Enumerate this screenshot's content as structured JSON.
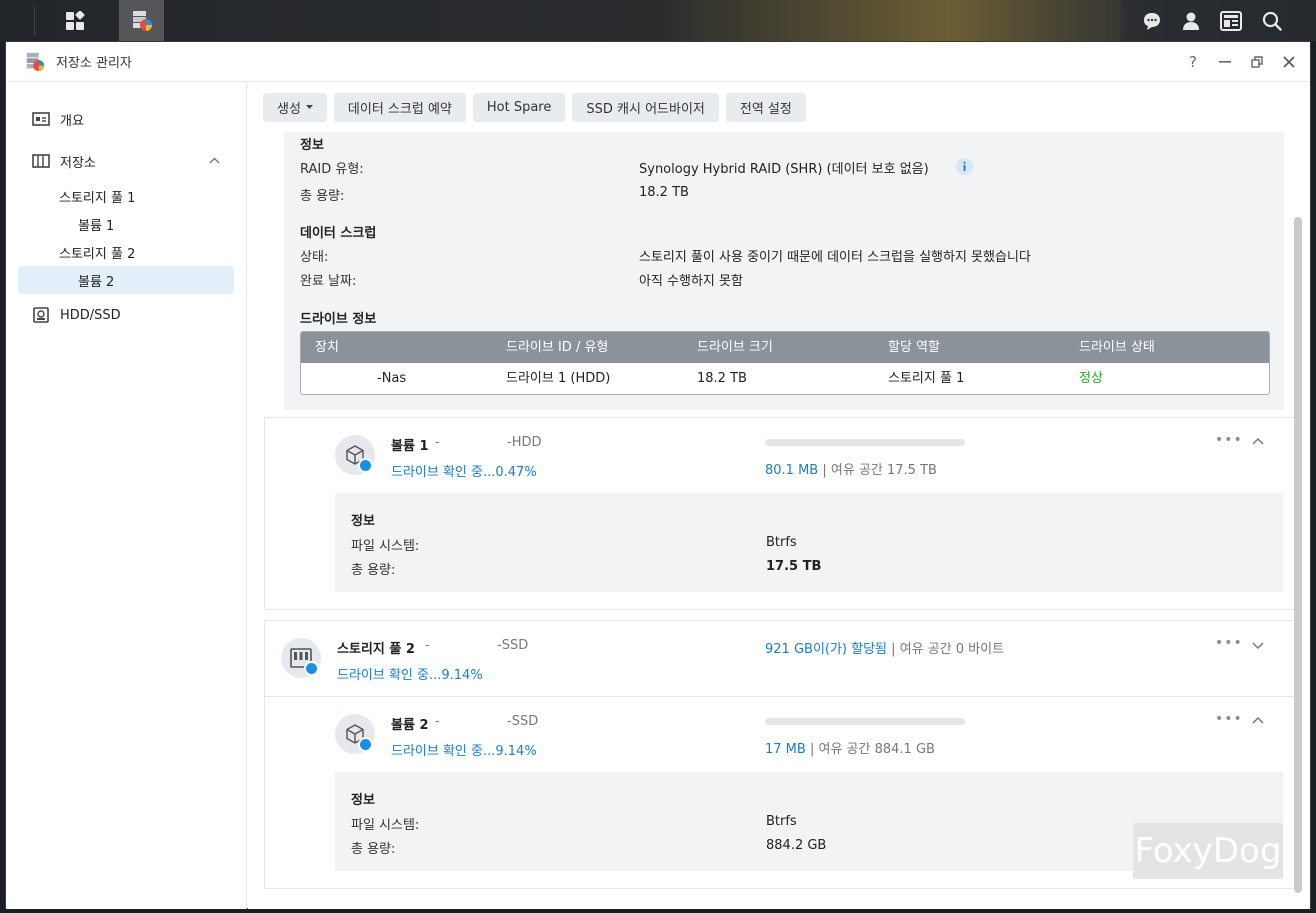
{
  "window": {
    "title": "저장소 관리자"
  },
  "toolbar": {
    "create": "생성",
    "scrub_schedule": "데이터 스크럽 예약",
    "hot_spare": "Hot Spare",
    "ssd_advisor": "SSD 캐시 어드바이저",
    "global_settings": "전역 설정"
  },
  "sidebar": {
    "overview": "개요",
    "storage": "저장소",
    "pool1": "스토리지 풀 1",
    "vol1": "볼륨 1",
    "pool2": "스토리지 풀 2",
    "vol2": "볼륨 2",
    "hddssd": "HDD/SSD"
  },
  "pool1_info": {
    "info_head": "정보",
    "raid_label": "RAID 유형:",
    "raid_value": "Synology Hybrid RAID (SHR) (데이터 보호 없음)",
    "capacity_label": "총 용량:",
    "capacity_value": "18.2 TB",
    "scrub_head": "데이터 스크럽",
    "status_label": "상태:",
    "status_value": "스토리지 풀이 사용 중이기 때문에 데이터 스크럽을 실행하지 못했습니다",
    "date_label": "완료 날짜:",
    "date_value": "아직 수행하지 못함",
    "drive_head": "드라이브 정보"
  },
  "drive_table": {
    "headers": [
      "장치",
      "드라이브 ID / 유형",
      "드라이브 크기",
      "할당 역할",
      "드라이브 상태"
    ],
    "row": [
      "-Nas",
      "드라이브 1 (HDD)",
      "18.2 TB",
      "스토리지 풀 1",
      "정상"
    ]
  },
  "volume1": {
    "name": "볼륨 1",
    "sep": "-",
    "type": "-HDD",
    "status": "드라이브 확인 중...0.47%",
    "used": "80.1 MB",
    "divider": "|",
    "free": "여유 공간 17.5 TB",
    "info_head": "정보",
    "fs_label": "파일 시스템:",
    "fs_value": "Btrfs",
    "cap_label": "총 용량:",
    "cap_value": "17.5 TB",
    "usage_fraction": 0.0
  },
  "pool2": {
    "name": "스토리지 풀 2",
    "sep": "-",
    "type": "-SSD",
    "status": "드라이브 확인 중...9.14%",
    "allocated": "921 GB이(가) 할당됨",
    "divider": "|",
    "free": "여유 공간 0 바이트"
  },
  "volume2": {
    "name": "볼륨 2",
    "sep": "-",
    "type": "-SSD",
    "status": "드라이브 확인 중...9.14%",
    "used": "17 MB",
    "divider": "|",
    "free": "여유 공간 884.1 GB",
    "info_head": "정보",
    "fs_label": "파일 시스템:",
    "fs_value": "Btrfs",
    "cap_label": "총 용량:",
    "cap_value": "884.2 GB",
    "usage_fraction": 0.0
  },
  "watermark": "FoxyDog",
  "colors": {
    "accent": "#1a7cc9",
    "ok": "#2e9e2e",
    "table_head": "#8c9299"
  }
}
